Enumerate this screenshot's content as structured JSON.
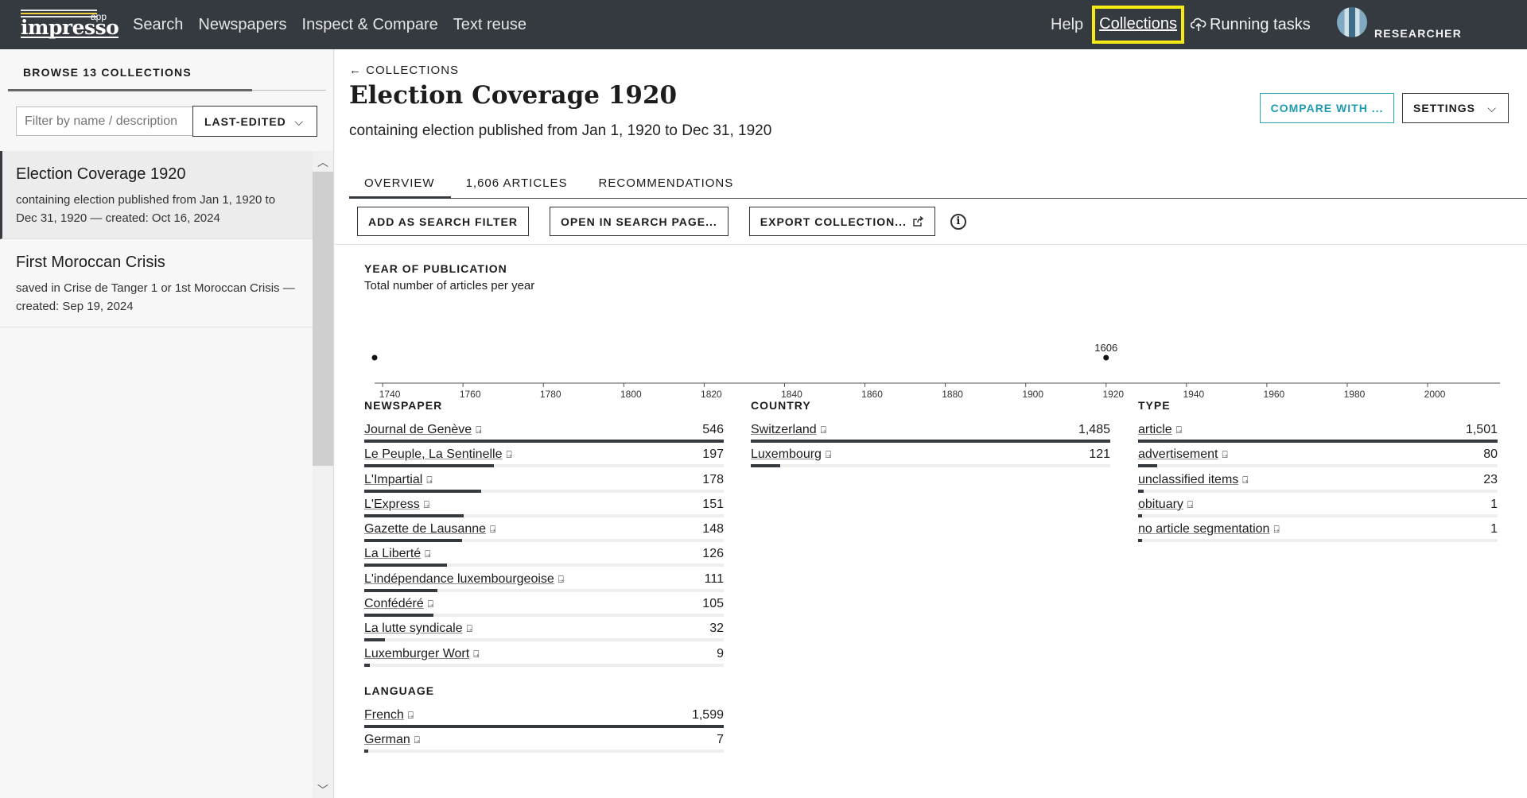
{
  "nav": {
    "logo_text": "impresso",
    "logo_app": "app",
    "links": [
      "Search",
      "Newspapers",
      "Inspect & Compare",
      "Text reuse"
    ],
    "help": "Help",
    "collections": "Collections",
    "running_tasks": "Running tasks",
    "role": "RESEARCHER"
  },
  "sidebar": {
    "title": "BROWSE 13 COLLECTIONS",
    "filter_placeholder": "Filter by name / description",
    "sort_label": "LAST-EDITED",
    "items": [
      {
        "title": "Election Coverage 1920",
        "desc": "containing election published from Jan 1, 1920 to Dec 31, 1920 — created: Oct 16, 2024"
      },
      {
        "title": "First Moroccan Crisis",
        "desc": "saved in Crise de Tanger 1 or 1st Moroccan Crisis — created: Sep 19, 2024"
      }
    ]
  },
  "main": {
    "back_label": "COLLECTIONS",
    "title": "Election Coverage 1920",
    "subtitle": "containing election published from Jan 1, 1920 to Dec 31, 1920",
    "compare_label": "COMPARE WITH ...",
    "settings_label": "SETTINGS",
    "tabs": [
      "OVERVIEW",
      "1,606 ARTICLES",
      "RECOMMENDATIONS"
    ],
    "actions": {
      "add_filter": "ADD AS SEARCH FILTER",
      "open_search": "OPEN IN SEARCH PAGE...",
      "export": "EXPORT COLLECTION..."
    },
    "timeline_title": "YEAR OF PUBLICATION",
    "timeline_subtitle": "Total number of articles per year"
  },
  "chart_data": {
    "type": "scatter",
    "title": "YEAR OF PUBLICATION",
    "subtitle": "Total number of articles per year",
    "x_ticks": [
      1740,
      1760,
      1780,
      1800,
      1820,
      1840,
      1860,
      1880,
      1900,
      1920,
      1940,
      1960,
      1980,
      2000
    ],
    "xlim": [
      1738,
      2018
    ],
    "points": [
      {
        "x": 1738,
        "y": 0
      },
      {
        "x": 1920,
        "y": 1606,
        "label": "1606"
      }
    ]
  },
  "facets": {
    "newspaper": {
      "title": "NEWSPAPER",
      "max": 546,
      "rows": [
        {
          "label": "Journal de Genève",
          "value": 546,
          "display": "546"
        },
        {
          "label": "Le Peuple, La Sentinelle",
          "value": 197,
          "display": "197"
        },
        {
          "label": "L'Impartial",
          "value": 178,
          "display": "178"
        },
        {
          "label": "L'Express",
          "value": 151,
          "display": "151"
        },
        {
          "label": "Gazette de Lausanne",
          "value": 148,
          "display": "148"
        },
        {
          "label": "La Liberté",
          "value": 126,
          "display": "126"
        },
        {
          "label": "L'indépendance luxembourgeoise",
          "value": 111,
          "display": "111"
        },
        {
          "label": "Confédéré",
          "value": 105,
          "display": "105"
        },
        {
          "label": "La lutte syndicale",
          "value": 32,
          "display": "32"
        },
        {
          "label": "Luxemburger Wort",
          "value": 9,
          "display": "9"
        }
      ]
    },
    "language": {
      "title": "LANGUAGE",
      "max": 1599,
      "rows": [
        {
          "label": "French",
          "value": 1599,
          "display": "1,599"
        },
        {
          "label": "German",
          "value": 7,
          "display": "7"
        }
      ]
    },
    "country": {
      "title": "COUNTRY",
      "max": 1485,
      "rows": [
        {
          "label": "Switzerland",
          "value": 1485,
          "display": "1,485"
        },
        {
          "label": "Luxembourg",
          "value": 121,
          "display": "121"
        }
      ]
    },
    "type": {
      "title": "TYPE",
      "max": 1501,
      "rows": [
        {
          "label": "article",
          "value": 1501,
          "display": "1,501"
        },
        {
          "label": "advertisement",
          "value": 80,
          "display": "80"
        },
        {
          "label": "unclassified items",
          "value": 23,
          "display": "23"
        },
        {
          "label": "obituary",
          "value": 1,
          "display": "1"
        },
        {
          "label": "no article segmentation",
          "value": 1,
          "display": "1"
        }
      ]
    }
  }
}
